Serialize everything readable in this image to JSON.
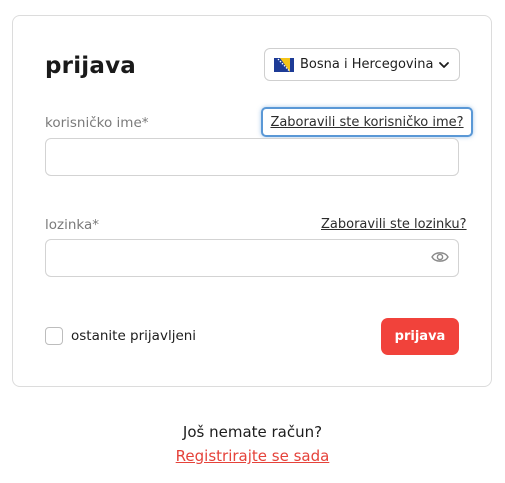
{
  "login": {
    "title": "prijava",
    "country": {
      "label": "Bosna i Hercegovina",
      "flag_icon": "bosnia-flag-icon"
    },
    "username": {
      "label": "korisničko ime*",
      "value": "",
      "forgot_link": "Zaboravili ste korisničko ime?"
    },
    "password": {
      "label": "lozinka*",
      "value": "",
      "forgot_link": "Zaboravili ste lozinku?"
    },
    "remember_label": "ostanite prijavljeni",
    "submit_label": "prijava"
  },
  "footer": {
    "prompt": "Još nemate račun?",
    "register_link": "Registrirajte se sada"
  },
  "colors": {
    "accent": "#f1423b",
    "link_red": "#e5423a",
    "focus_ring": "#5a98d6",
    "flag_blue": "#1d3b96",
    "flag_yellow": "#f5c518"
  }
}
